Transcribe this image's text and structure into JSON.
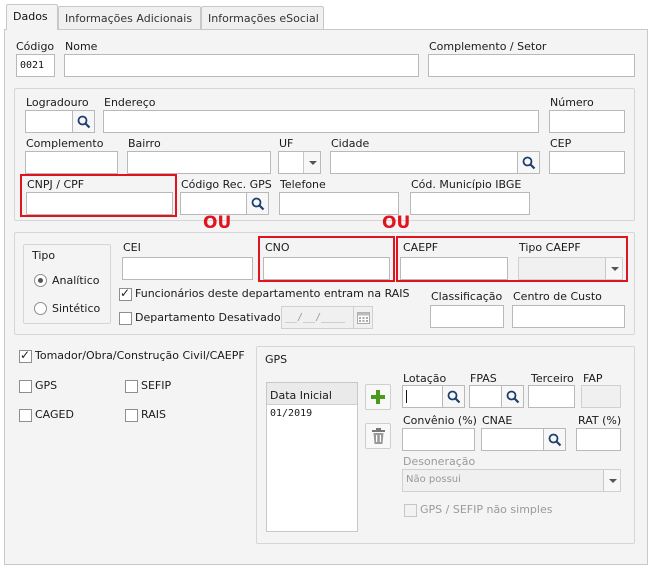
{
  "tabs": [
    "Dados",
    "Informações Adicionais",
    "Informações eSocial"
  ],
  "fields": {
    "codigo": {
      "label": "Código",
      "value": "0021"
    },
    "nome": {
      "label": "Nome"
    },
    "complemento_setor": {
      "label": "Complemento / Setor"
    },
    "logradouro": {
      "label": "Logradouro"
    },
    "endereco": {
      "label": "Endereço"
    },
    "numero": {
      "label": "Número"
    },
    "complemento": {
      "label": "Complemento"
    },
    "bairro": {
      "label": "Bairro"
    },
    "uf": {
      "label": "UF"
    },
    "cidade": {
      "label": "Cidade"
    },
    "cep": {
      "label": "CEP"
    },
    "cnpj_cpf": {
      "label": "CNPJ / CPF"
    },
    "codigo_rec_gps": {
      "label": "Código Rec. GPS"
    },
    "telefone": {
      "label": "Telefone"
    },
    "cod_municipio_ibge": {
      "label": "Cód. Município IBGE"
    },
    "cei": {
      "label": "CEI"
    },
    "cno": {
      "label": "CNO"
    },
    "caepf": {
      "label": "CAEPF"
    },
    "tipo_caepf": {
      "label": "Tipo CAEPF"
    },
    "classificacao": {
      "label": "Classificação"
    },
    "centro_custo": {
      "label": "Centro de Custo"
    },
    "data_desativado": {
      "value": "__/__/____"
    }
  },
  "annotations": {
    "ou": "OU"
  },
  "tipo": {
    "label": "Tipo",
    "options": [
      "Analítico",
      "Sintético"
    ],
    "selected": "Analítico"
  },
  "checkboxes": {
    "funcionarios_rais": {
      "label": "Funcionários deste departamento entram na RAIS",
      "checked": true
    },
    "departamento_desativado": {
      "label": "Departamento Desativado",
      "checked": false
    },
    "tomador": {
      "label": "Tomador/Obra/Construção Civil/CAEPF",
      "checked": true
    },
    "gps": {
      "label": "GPS",
      "checked": false
    },
    "sefip": {
      "label": "SEFIP",
      "checked": false
    },
    "caged": {
      "label": "CAGED",
      "checked": false
    },
    "rais": {
      "label": "RAIS",
      "checked": false
    }
  },
  "gps_panel": {
    "title": "GPS",
    "list_header": "Data Inicial",
    "rows": [
      "01/2019"
    ],
    "lotacao": "Lotação",
    "fpas": "FPAS",
    "terceiro": "Terceiro",
    "fap": "FAP",
    "convenio": "Convênio (%)",
    "cnae": "CNAE",
    "rat": "RAT (%)",
    "desoneracao": {
      "label": "Desoneração",
      "value": "Não possui"
    },
    "gps_sefip": {
      "label": "GPS / SEFIP não simples",
      "checked": false
    }
  }
}
